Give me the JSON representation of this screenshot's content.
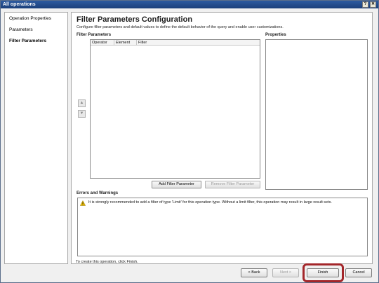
{
  "window": {
    "title": "All operations",
    "help_glyph": "?",
    "close_glyph": "✕"
  },
  "nav": {
    "items": [
      {
        "label": "Operation Properties",
        "active": false
      },
      {
        "label": "Parameters",
        "active": false
      },
      {
        "label": "Filter Parameters",
        "active": true
      }
    ]
  },
  "main": {
    "title": "Filter Parameters Configuration",
    "description": "Configure filter parameters and default values to define the default behavior of the query and enable user customizations.",
    "filter_section_label": "Filter Parameters",
    "properties_label": "Properties",
    "columns": [
      "Operator",
      "Element",
      "Filter"
    ],
    "move_up_glyph": "▲",
    "move_down_glyph": "▼",
    "add_button": "Add Filter Parameter",
    "remove_button": "Remove Filter Parameter"
  },
  "errors": {
    "label": "Errors and Warnings",
    "message": "It is strongly recommended to add a filter of type 'Limit' for this operation type. Without a limit filter, this operation may result in large result sets."
  },
  "footer": {
    "note": "To create this operation, click Finish.",
    "back": "< Back",
    "next": "Next >",
    "finish": "Finish",
    "cancel": "Cancel"
  },
  "colors": {
    "title_bar": "#1b3f7a",
    "highlight": "#a3262a",
    "warning": "#f5c400"
  }
}
